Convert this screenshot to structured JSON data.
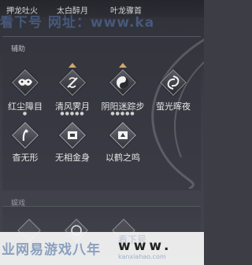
{
  "top_bar": {
    "items": [
      "押龙吐火",
      "太白醉月",
      "叶龙骤首"
    ]
  },
  "watermark_top": "看下号  网址：www.ka",
  "section_auxiliary": {
    "title": "辅助"
  },
  "skills": [
    {
      "name": "红尘障目",
      "dots": "●",
      "has_cap": false
    },
    {
      "name": "清风霁月",
      "dots": "●●●●●",
      "has_cap": true
    },
    {
      "name": "阴阳迷踪步",
      "dots": "●●●●●",
      "has_cap": true
    },
    {
      "name": "萤光晖夜",
      "dots": "",
      "has_cap": false
    },
    {
      "name": "杳无形",
      "dots": "",
      "has_cap": false
    },
    {
      "name": "无相金身",
      "dots": "",
      "has_cap": false
    },
    {
      "name": "以鹤之鸣",
      "dots": "",
      "has_cap": false
    }
  ],
  "section_entertainment": {
    "title": "娱戏"
  },
  "watermark_bottom": {
    "left": "业网易游戏八年",
    "faint": "看下号",
    "url": "www.",
    "sub": "kanxiahao.com"
  },
  "icons": {
    "skill_1": "mask-icon",
    "skill_2": "wind-blade-icon",
    "skill_3": "yin-yang-icon",
    "skill_4": "firefly-swirl-icon",
    "skill_5": "vanish-figure-icon",
    "skill_6": "golden-body-icon",
    "skill_7": "crane-cry-icon"
  }
}
